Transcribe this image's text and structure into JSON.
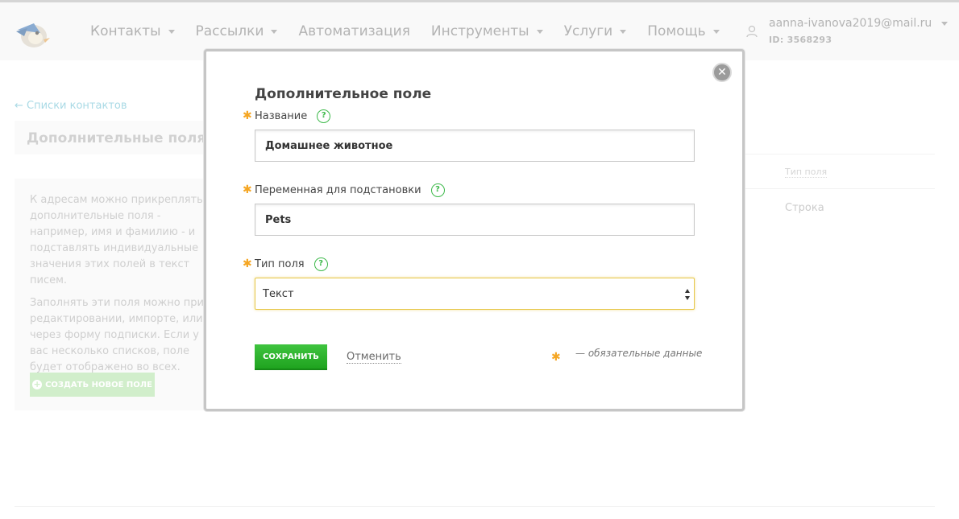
{
  "header": {
    "nav": [
      {
        "label": "Контакты",
        "dropdown": true
      },
      {
        "label": "Рассылки",
        "dropdown": true
      },
      {
        "label": "Автоматизация",
        "dropdown": false
      },
      {
        "label": "Инструменты",
        "dropdown": true
      },
      {
        "label": "Услуги",
        "dropdown": true
      },
      {
        "label": "Помощь",
        "dropdown": true
      }
    ],
    "user": {
      "email": "aanna-ivanova2019@mail.ru",
      "id": "ID: 3568293"
    }
  },
  "page": {
    "back_link": "← Списки контактов",
    "title": "Дополнительные поля",
    "info_paragraphs": [
      "К адресам можно прикреплять дополнительные поля - например, имя и фамилию - и подставлять индивидуальные значения этих полей в текст писем.",
      "Заполнять эти поля можно при редактировании, импорте, или через форму подписки. Если у вас несколько списков, поле будет отображено во всех."
    ],
    "create_button": "СОЗДАТЬ НОВОЕ ПОЛЕ",
    "table": {
      "column_type_header": "Тип поля",
      "rows": [
        {
          "type": "Строка"
        }
      ]
    }
  },
  "modal": {
    "title": "Дополнительное поле",
    "required_mark": "✱",
    "help_icon": "?",
    "close_icon": "✕",
    "fields": {
      "name": {
        "label": "Название",
        "value": "Домашнее животное"
      },
      "variable": {
        "label": "Переменная для подстановки",
        "value": "Pets"
      },
      "type": {
        "label": "Тип поля",
        "value": "Текст"
      }
    },
    "save_button": "СОХРАНИТЬ",
    "cancel_link": "Отменить",
    "required_note": "— обязательные данные"
  },
  "colors": {
    "accent_green": "#2cb52c",
    "required_star": "#f5a623",
    "link": "#7cc6d8",
    "focus_border": "#e7c84d"
  }
}
